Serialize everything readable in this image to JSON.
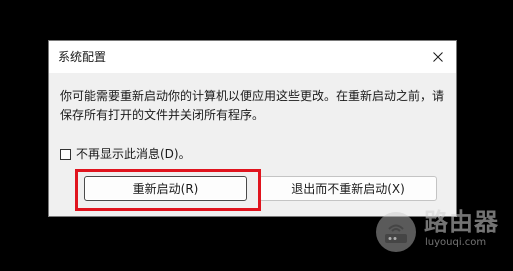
{
  "dialog": {
    "title": "系统配置",
    "message_line1": "你可能需要重新启动你的计算机以便应用这些更改。在重新启动之前，请",
    "message_line2": "保存所有打开的文件并关闭所有程序。",
    "checkbox_label": "不再显示此消息(D)。",
    "checkbox_checked": false,
    "restart_button": "重新启动(R)",
    "exit_button": "退出而不重新启动(X)",
    "close_icon": "close-icon"
  },
  "annotation": {
    "highlight_color": "#e0141e"
  },
  "watermark": {
    "name": "路由器",
    "url": "luyouqi.com",
    "icon": "router-logo-icon"
  }
}
